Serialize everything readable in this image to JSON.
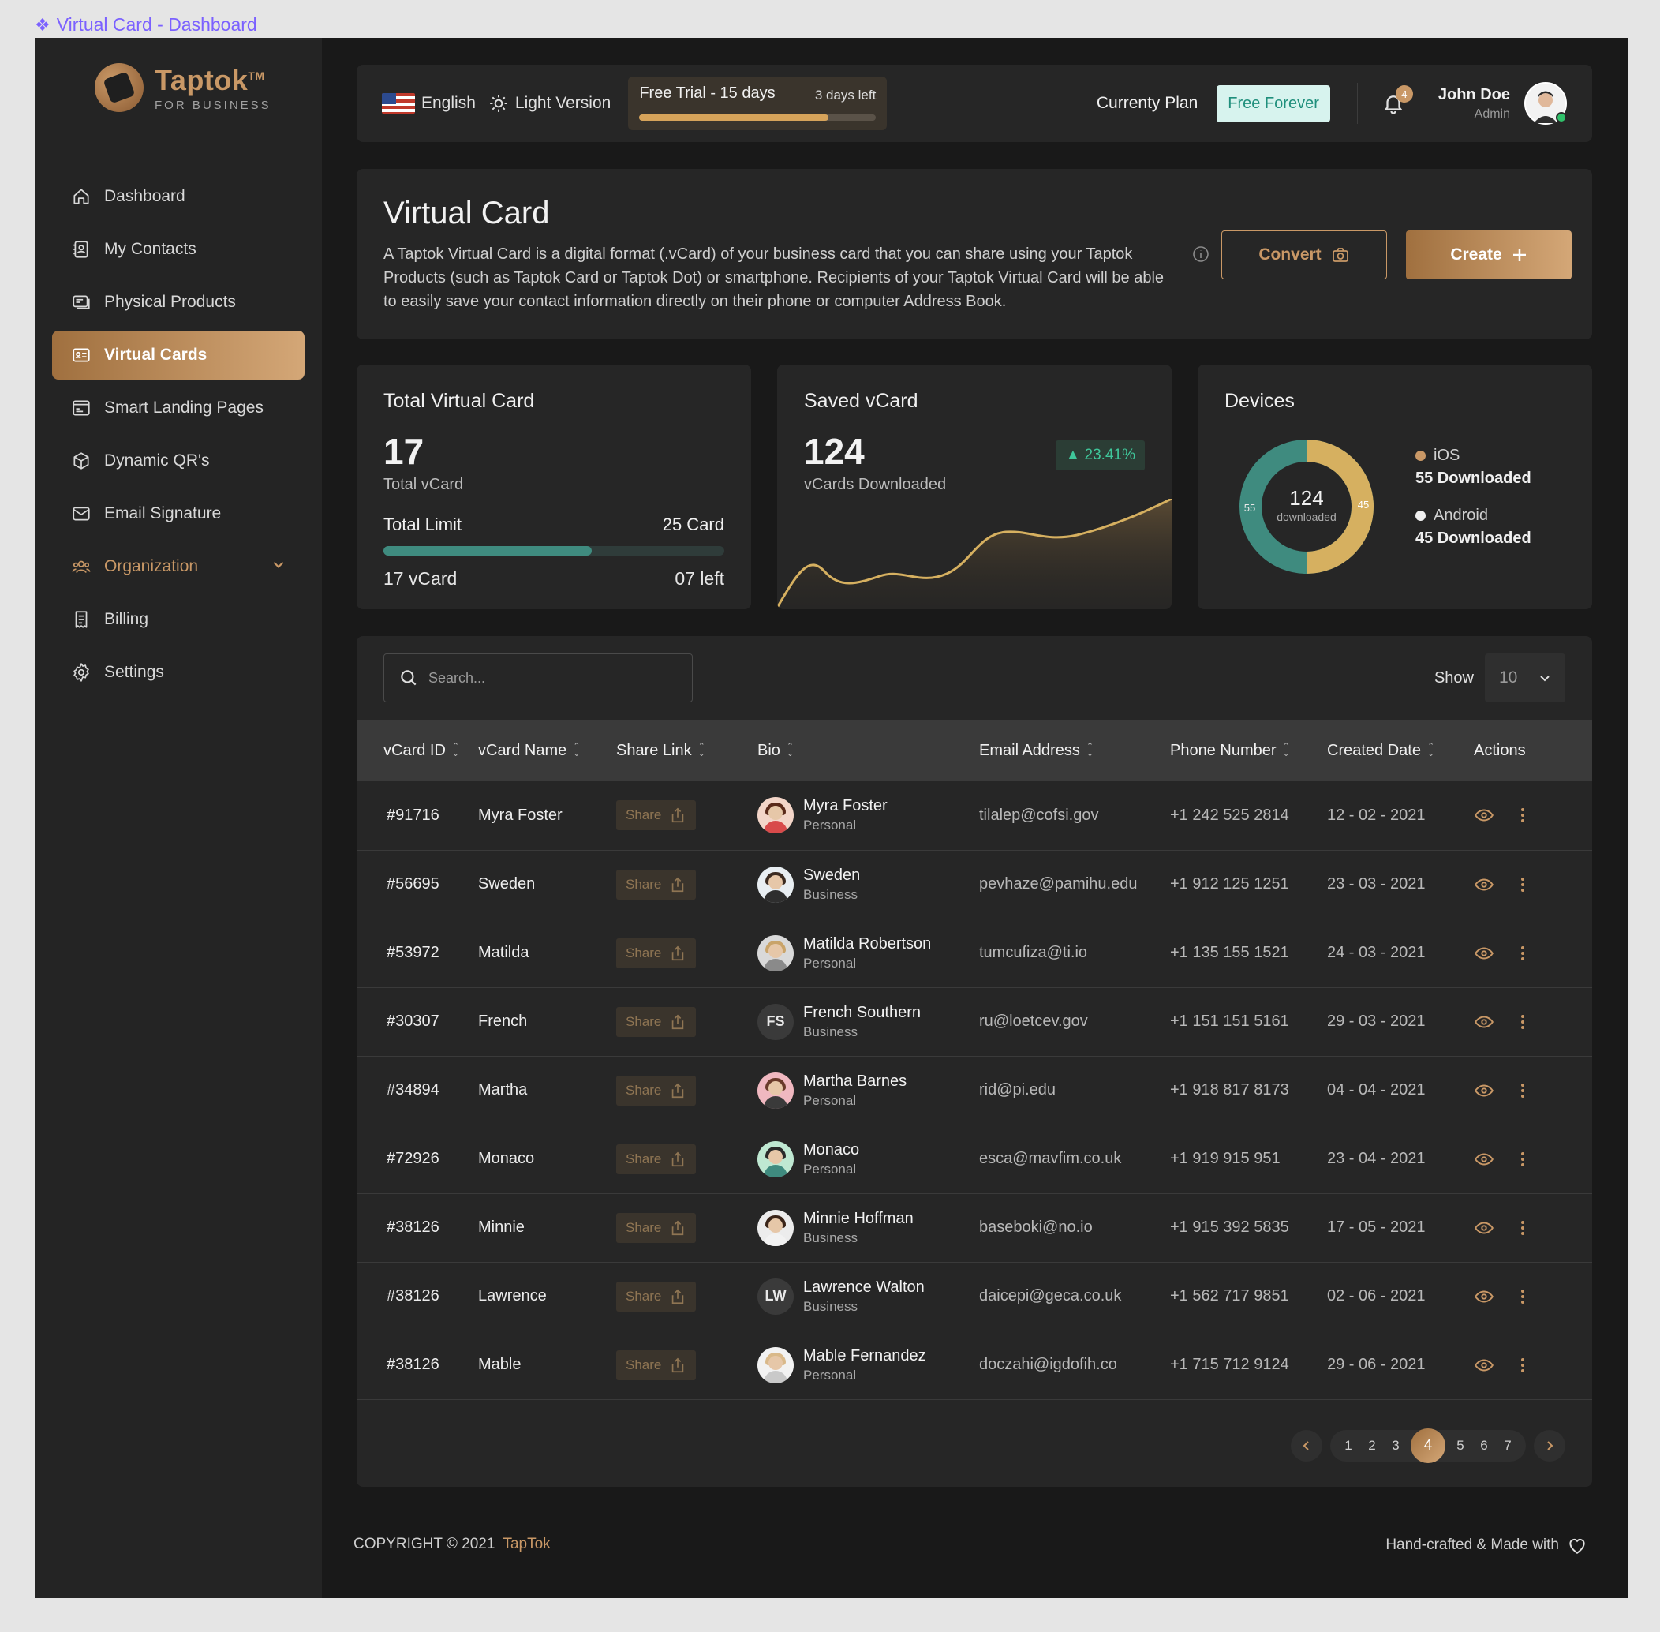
{
  "frame": {
    "title": "Virtual Card - Dashboard"
  },
  "brand": {
    "name": "Taptok",
    "tm": "TM",
    "tagline": "FOR BUSINESS"
  },
  "sidebar": {
    "items": [
      {
        "label": "Dashboard",
        "icon": "home-icon"
      },
      {
        "label": "My Contacts",
        "icon": "contacts-icon"
      },
      {
        "label": "Physical Products",
        "icon": "products-icon"
      },
      {
        "label": "Virtual Cards",
        "icon": "id-card-icon",
        "active": true
      },
      {
        "label": "Smart Landing Pages",
        "icon": "browser-icon"
      },
      {
        "label": "Dynamic QR's",
        "icon": "cube-icon"
      },
      {
        "label": "Email Signature",
        "icon": "mail-icon"
      },
      {
        "label": "Organization",
        "icon": "team-icon",
        "expandable": true
      },
      {
        "label": "Billing",
        "icon": "receipt-icon"
      },
      {
        "label": "Settings",
        "icon": "gear-icon"
      }
    ]
  },
  "topbar": {
    "language": "English",
    "theme": "Light Version",
    "trial": {
      "label": "Free Trial - 15 days",
      "remaining": "3 days left",
      "progress": 0.8
    },
    "plan_label": "Currenty Plan",
    "plan_value": "Free Forever",
    "notifications": "4",
    "user": {
      "name": "John Doe",
      "role": "Admin"
    }
  },
  "hero": {
    "title": "Virtual Card",
    "description": "A Taptok Virtual Card is a digital format (.vCard) of your business card that you can share using your Taptok Products (such as Taptok Card or Taptok Dot) or smartphone. Recipients of your Taptok Virtual Card will be able to easily save your contact information directly on their phone or computer Address Book.",
    "convert_label": "Convert",
    "create_label": "Create"
  },
  "stats": {
    "total": {
      "title": "Total Virtual Card",
      "value": "17",
      "sub": "Total vCard",
      "limit_label": "Total Limit",
      "limit_value": "25 Card",
      "used": "17 vCard",
      "left": "07 left",
      "progress": 0.61
    },
    "saved": {
      "title": "Saved vCard",
      "value": "124",
      "sub": "vCards Downloaded",
      "trend": "23.41%"
    },
    "devices": {
      "title": "Devices",
      "center_value": "124",
      "center_label": "downloaded",
      "ios_short": "55",
      "android_short": "45",
      "ios_label": "iOS",
      "ios_value": "55 Downloaded",
      "android_label": "Android",
      "android_value": "45 Downloaded",
      "ios_color": "#3f8b7f",
      "android_color": "#d6b060"
    }
  },
  "table": {
    "search_placeholder": "Search...",
    "show_label": "Show",
    "page_size": "10",
    "columns": [
      "vCard ID",
      "vCard Name",
      "Share Link",
      "Bio",
      "Email Address",
      "Phone Number",
      "Created Date",
      "Actions"
    ],
    "share_label": "Share",
    "rows": [
      {
        "id": "#91716",
        "name": "Myra Foster",
        "bio_name": "Myra Foster",
        "bio_type": "Personal",
        "email": "tilalep@cofsi.gov",
        "phone": "+1 242 525 2814",
        "date": "12 - 02 - 2021",
        "avatar": "photo",
        "initials": "",
        "bg": "#f3d5c8",
        "hair": "#5a2a1a",
        "shirt": "#d84a4a"
      },
      {
        "id": "#56695",
        "name": "Sweden",
        "bio_name": "Sweden",
        "bio_type": "Business",
        "email": "pevhaze@pamihu.edu",
        "phone": "+1 912 125 1251",
        "date": "23 - 03 - 2021",
        "avatar": "photo",
        "initials": "",
        "bg": "#e8eef2",
        "hair": "#3a2a20",
        "shirt": "#2e2e2e"
      },
      {
        "id": "#53972",
        "name": "Matilda",
        "bio_name": "Matilda Robertson",
        "bio_type": "Personal",
        "email": "tumcufiza@ti.io",
        "phone": "+1 135 155 1521",
        "date": "24 - 03 - 2021",
        "avatar": "photo",
        "initials": "",
        "bg": "#d9d9d9",
        "hair": "#c9a46a",
        "shirt": "#8a8a8a"
      },
      {
        "id": "#30307",
        "name": "French",
        "bio_name": "French Southern",
        "bio_type": "Business",
        "email": "ru@loetcev.gov",
        "phone": "+1 151 151 5161",
        "date": "29 - 03 - 2021",
        "avatar": "initials",
        "initials": "FS",
        "bg": "#3a3a3a"
      },
      {
        "id": "#34894",
        "name": "Martha",
        "bio_name": "Martha Barnes",
        "bio_type": "Personal",
        "email": "rid@pi.edu",
        "phone": "+1 918 817 8173",
        "date": "04 - 04 - 2021",
        "avatar": "photo",
        "initials": "",
        "bg": "#f0b8c0",
        "hair": "#6a3a2a",
        "shirt": "#3a3a3a"
      },
      {
        "id": "#72926",
        "name": "Monaco",
        "bio_name": "Monaco",
        "bio_type": "Personal",
        "email": "esca@mavfim.co.uk",
        "phone": "+1 919 915 951",
        "date": "23 - 04 - 2021",
        "avatar": "photo",
        "initials": "",
        "bg": "#bfe8d2",
        "hair": "#2a2a2a",
        "shirt": "#3f8b7f"
      },
      {
        "id": "#38126",
        "name": "Minnie",
        "bio_name": "Minnie Hoffman",
        "bio_type": "Business",
        "email": "baseboki@no.io",
        "phone": "+1 915 392 5835",
        "date": "17 - 05 - 2021",
        "avatar": "photo",
        "initials": "",
        "bg": "#ececec",
        "hair": "#3a2418",
        "shirt": "#f2f2f2"
      },
      {
        "id": "#38126",
        "name": "Lawrence",
        "bio_name": "Lawrence Walton",
        "bio_type": "Business",
        "email": "daicepi@geca.co.uk",
        "phone": "+1 562 717 9851",
        "date": "02 - 06 - 2021",
        "avatar": "initials",
        "initials": "LW",
        "bg": "#3a3a3a"
      },
      {
        "id": "#38126",
        "name": "Mable",
        "bio_name": "Mable Fernandez",
        "bio_type": "Personal",
        "email": "doczahi@igdofih.co",
        "phone": "+1 715 712 9124",
        "date": "29 - 06 - 2021",
        "avatar": "photo",
        "initials": "",
        "bg": "#f2f2f2",
        "hair": "#d9b98a",
        "shirt": "#c9c9c9"
      }
    ]
  },
  "pagination": {
    "pages": [
      "1",
      "2",
      "3",
      "4",
      "5",
      "6",
      "7"
    ],
    "current": "4"
  },
  "footer": {
    "copyright": "COPYRIGHT © 2021",
    "brand": "TapTok",
    "made_with": "Hand-crafted & Made with"
  }
}
